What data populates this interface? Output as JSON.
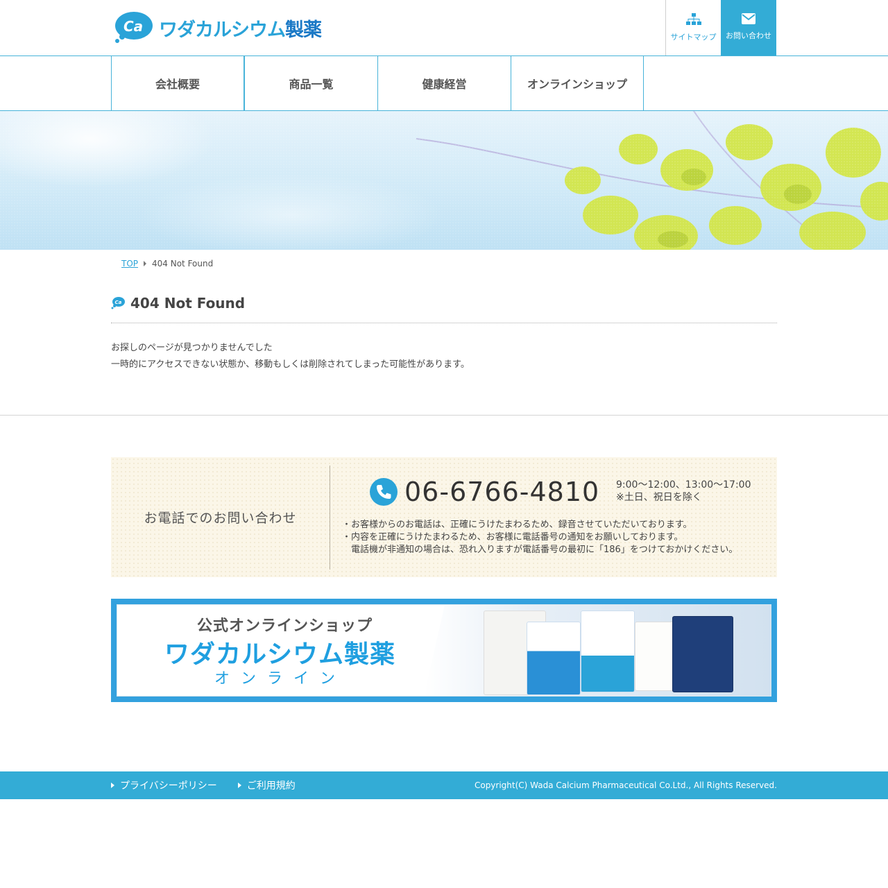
{
  "header": {
    "logo_kana": "ワダカルシウム",
    "logo_kanji": "製薬",
    "sitemap_label": "サイトマップ",
    "contact_label": "お問い合わせ"
  },
  "gnav": [
    {
      "label": "会社概要"
    },
    {
      "label": "商品一覧"
    },
    {
      "label": "健康経営"
    },
    {
      "label": "オンラインショップ"
    }
  ],
  "breadcrumb": {
    "home": "TOP",
    "current": "404 Not Found"
  },
  "page": {
    "title": "404 Not Found",
    "line1": "お探しのページが見つかりませんでした",
    "line2": "一時的にアクセスできない状態か、移動もしくは削除されてしまった可能性があります。"
  },
  "phone_box": {
    "heading": "お電話でのお問い合わせ",
    "number": "06-6766-4810",
    "hours": "9:00〜12:00、13:00〜17:00",
    "holidays": "※土日、祝日を除く",
    "note1": "・お客様からのお電話は、正確にうけたまわるため、録音させていただいております。",
    "note2": "・内容を正確にうけたまわるため、お客様に電話番号の通知をお願いしております。",
    "note3": "電話機が非通知の場合は、恐れ入りますが電話番号の最初に「186」をつけておかけください。"
  },
  "shop_banner": {
    "tagline": "公式オンラインショップ",
    "brand": "ワダカルシウム製薬",
    "sub": "オンライン"
  },
  "footer": {
    "privacy": "プライバシーポリシー",
    "terms": "ご利用規約",
    "copyright": "Copyright(C) Wada Calcium Pharmaceutical Co.Ltd., All Rights Reserved."
  },
  "colors": {
    "accent": "#33acd6",
    "nav_border": "#47b3d9",
    "link": "#2aa3d8",
    "phone_bg": "#fbf6e8"
  }
}
